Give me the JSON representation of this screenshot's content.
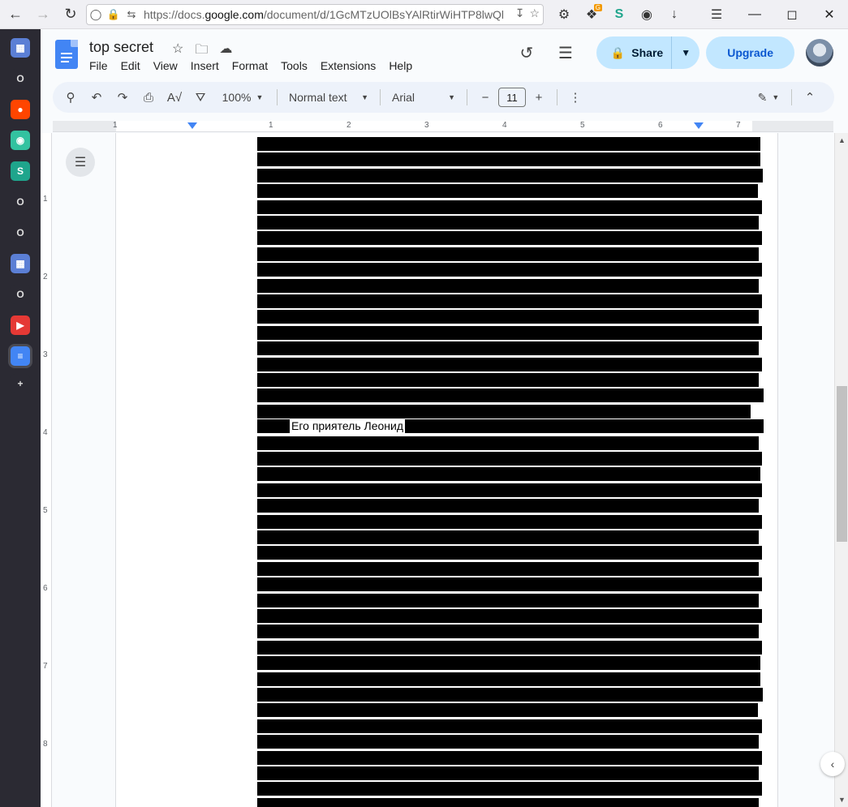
{
  "browser": {
    "url_prefix": "https://docs.",
    "url_domain": "google.com",
    "url_rest": "/document/d/1GcMTzUOlBsYAlRtirWiHTP8lwQl",
    "extension_badge": "G"
  },
  "sidebar": {
    "items": [
      {
        "name": "calendar-app",
        "glyph": "▦",
        "color": "#5b7fd5"
      },
      {
        "name": "o-app-1",
        "glyph": "O",
        "color": "#2b2a33"
      },
      {
        "name": "reddit",
        "glyph": "●",
        "color": "#ff4500"
      },
      {
        "name": "game-app",
        "glyph": "◉",
        "color": "#33c2a0"
      },
      {
        "name": "s-app",
        "glyph": "S",
        "color": "#1fa58c"
      },
      {
        "name": "o-app-2",
        "glyph": "O",
        "color": "#2b2a33"
      },
      {
        "name": "o-app-3",
        "glyph": "O",
        "color": "#2b2a33"
      },
      {
        "name": "calendar-app-2",
        "glyph": "▦",
        "color": "#5b7fd5"
      },
      {
        "name": "o-app-4",
        "glyph": "O",
        "color": "#2b2a33"
      },
      {
        "name": "youtube",
        "glyph": "▶",
        "color": "#e53935"
      },
      {
        "name": "google-docs",
        "glyph": "≡",
        "color": "#4285f4"
      },
      {
        "name": "add",
        "glyph": "+",
        "color": "#2b2a33"
      }
    ]
  },
  "docs": {
    "title": "top secret",
    "menu": [
      "File",
      "Edit",
      "View",
      "Insert",
      "Format",
      "Tools",
      "Extensions",
      "Help"
    ],
    "share_label": "Share",
    "upgrade_label": "Upgrade"
  },
  "toolbar": {
    "zoom": "100%",
    "style": "Normal text",
    "font": "Arial",
    "font_size": "11"
  },
  "ruler": {
    "h_numbers": [
      "1",
      "1",
      "2",
      "3",
      "4",
      "5",
      "6",
      "7"
    ],
    "v_numbers": [
      "1",
      "2",
      "3",
      "4",
      "5",
      "6",
      "7",
      "8"
    ]
  },
  "document": {
    "visible_text": "Его приятель Леонид"
  }
}
